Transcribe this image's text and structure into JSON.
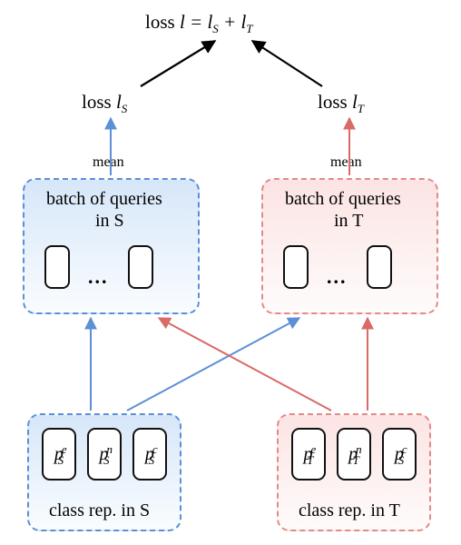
{
  "top_loss": {
    "prefix": "loss ",
    "eq": "l = l",
    "s1": "S",
    "plus": " + l",
    "s2": "T"
  },
  "left": {
    "loss_label_prefix": "loss ",
    "loss_var": "l",
    "loss_sub": "S",
    "mean": "mean",
    "queries_line1": "batch of queries",
    "queries_line2": "in S",
    "rep_label": "class rep. in S",
    "p": {
      "base": "p",
      "sub": "S",
      "sups": [
        "e",
        "n",
        "c"
      ]
    }
  },
  "right": {
    "loss_label_prefix": "loss ",
    "loss_var": "l",
    "loss_sub": "T",
    "mean": "mean",
    "queries_line1": "batch of queries",
    "queries_line2": "in T",
    "rep_label": "class rep. in T",
    "p": {
      "base": "p",
      "subs": [
        "T",
        "T",
        "S"
      ],
      "sups": [
        "e",
        "n",
        "c"
      ]
    }
  },
  "ellipsis": "..."
}
